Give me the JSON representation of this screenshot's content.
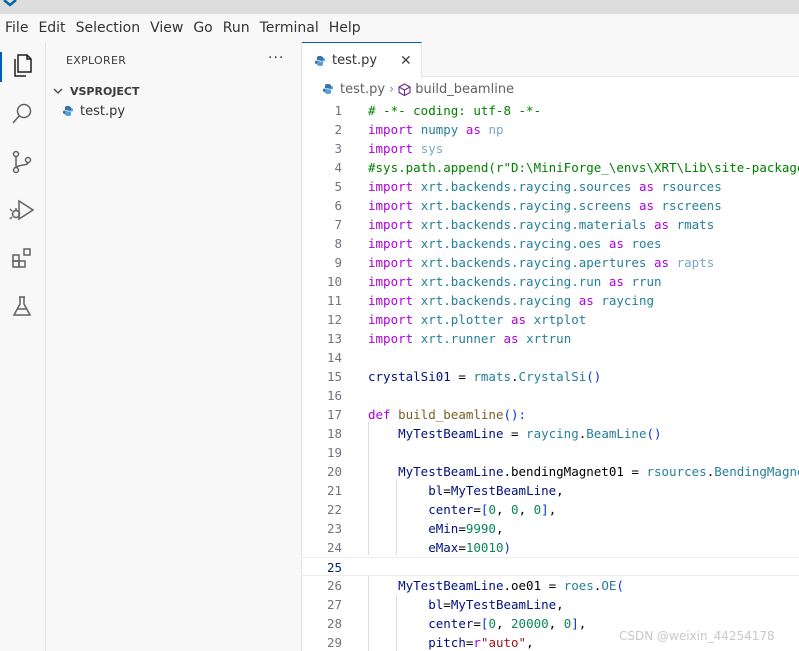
{
  "menu": [
    "File",
    "Edit",
    "Selection",
    "View",
    "Go",
    "Run",
    "Terminal",
    "Help"
  ],
  "activity_icons": [
    "explorer-icon",
    "search-icon",
    "source-control-icon",
    "run-debug-icon",
    "extensions-icon",
    "testing-icon"
  ],
  "sidebar": {
    "title": "EXPLORER",
    "more": "···",
    "folder": "VSPROJECT",
    "files": [
      "test.py"
    ]
  },
  "tab": {
    "label": "test.py",
    "close": "✕"
  },
  "breadcrumb": {
    "file": "test.py",
    "sep": "›",
    "symbol": "build_beamline"
  },
  "editor": {
    "current_line": 25,
    "lines": [
      {
        "n": "1",
        "t": [
          [
            "# -*- coding: utf-8 -*-",
            "c"
          ]
        ]
      },
      {
        "n": "2",
        "t": [
          [
            "import",
            "k"
          ],
          [
            " ",
            "o"
          ],
          [
            "numpy",
            "m"
          ],
          [
            " ",
            "o"
          ],
          [
            "as",
            "k"
          ],
          [
            " ",
            "o"
          ],
          [
            "np",
            "dim"
          ]
        ]
      },
      {
        "n": "3",
        "t": [
          [
            "import",
            "k"
          ],
          [
            " ",
            "o"
          ],
          [
            "sys",
            "dim"
          ]
        ]
      },
      {
        "n": "4",
        "t": [
          [
            "#sys.path.append(r\"D:\\MiniForge_\\envs\\XRT\\Lib\\site-packages\")",
            "c"
          ]
        ]
      },
      {
        "n": "5",
        "t": [
          [
            "import",
            "k"
          ],
          [
            " ",
            "o"
          ],
          [
            "xrt.backends.raycing.sources",
            "m"
          ],
          [
            " ",
            "o"
          ],
          [
            "as",
            "k"
          ],
          [
            " ",
            "o"
          ],
          [
            "rsources",
            "m"
          ]
        ]
      },
      {
        "n": "6",
        "t": [
          [
            "import",
            "k"
          ],
          [
            " ",
            "o"
          ],
          [
            "xrt.backends.raycing.screens",
            "m"
          ],
          [
            " ",
            "o"
          ],
          [
            "as",
            "k"
          ],
          [
            " ",
            "o"
          ],
          [
            "rscreens",
            "m"
          ]
        ]
      },
      {
        "n": "7",
        "t": [
          [
            "import",
            "k"
          ],
          [
            " ",
            "o"
          ],
          [
            "xrt.backends.raycing.materials",
            "m"
          ],
          [
            " ",
            "o"
          ],
          [
            "as",
            "k"
          ],
          [
            " ",
            "o"
          ],
          [
            "rmats",
            "m"
          ]
        ]
      },
      {
        "n": "8",
        "t": [
          [
            "import",
            "k"
          ],
          [
            " ",
            "o"
          ],
          [
            "xrt.backends.raycing.oes",
            "m"
          ],
          [
            " ",
            "o"
          ],
          [
            "as",
            "k"
          ],
          [
            " ",
            "o"
          ],
          [
            "roes",
            "m"
          ]
        ]
      },
      {
        "n": "9",
        "t": [
          [
            "import",
            "k"
          ],
          [
            " ",
            "o"
          ],
          [
            "xrt.backends.raycing.apertures",
            "m"
          ],
          [
            " ",
            "o"
          ],
          [
            "as",
            "k"
          ],
          [
            " ",
            "o"
          ],
          [
            "rapts",
            "dim"
          ]
        ]
      },
      {
        "n": "10",
        "t": [
          [
            "import",
            "k"
          ],
          [
            " ",
            "o"
          ],
          [
            "xrt.backends.raycing.run",
            "m"
          ],
          [
            " ",
            "o"
          ],
          [
            "as",
            "k"
          ],
          [
            " ",
            "o"
          ],
          [
            "rrun",
            "m"
          ]
        ]
      },
      {
        "n": "11",
        "t": [
          [
            "import",
            "k"
          ],
          [
            " ",
            "o"
          ],
          [
            "xrt.backends.raycing",
            "m"
          ],
          [
            " ",
            "o"
          ],
          [
            "as",
            "k"
          ],
          [
            " ",
            "o"
          ],
          [
            "raycing",
            "m"
          ]
        ]
      },
      {
        "n": "12",
        "t": [
          [
            "import",
            "k"
          ],
          [
            " ",
            "o"
          ],
          [
            "xrt.plotter",
            "m"
          ],
          [
            " ",
            "o"
          ],
          [
            "as",
            "k"
          ],
          [
            " ",
            "o"
          ],
          [
            "xrtplot",
            "m"
          ]
        ]
      },
      {
        "n": "13",
        "t": [
          [
            "import",
            "k"
          ],
          [
            " ",
            "o"
          ],
          [
            "xrt.runner",
            "m"
          ],
          [
            " ",
            "o"
          ],
          [
            "as",
            "k"
          ],
          [
            " ",
            "o"
          ],
          [
            "xrtrun",
            "m"
          ]
        ]
      },
      {
        "n": "14",
        "t": []
      },
      {
        "n": "15",
        "t": [
          [
            "crystalSi01",
            "v"
          ],
          [
            " = ",
            "o"
          ],
          [
            "rmats",
            "m"
          ],
          [
            ".",
            "o"
          ],
          [
            "CrystalSi",
            "m"
          ],
          [
            "()",
            "p"
          ]
        ]
      },
      {
        "n": "16",
        "t": []
      },
      {
        "n": "17",
        "t": [
          [
            "def",
            "k"
          ],
          [
            " ",
            "o"
          ],
          [
            "build_beamline",
            "f"
          ],
          [
            "():",
            "p"
          ]
        ]
      },
      {
        "n": "18",
        "t": [
          [
            "    ",
            "o"
          ],
          [
            "MyTestBeamLine",
            "v"
          ],
          [
            " = ",
            "o"
          ],
          [
            "raycing",
            "m"
          ],
          [
            ".",
            "o"
          ],
          [
            "BeamLine",
            "m"
          ],
          [
            "()",
            "p"
          ]
        ]
      },
      {
        "n": "19",
        "t": []
      },
      {
        "n": "20",
        "t": [
          [
            "    ",
            "o"
          ],
          [
            "MyTestBeamLine",
            "v"
          ],
          [
            ".bendingMagnet01 = ",
            "o"
          ],
          [
            "rsources",
            "m"
          ],
          [
            ".",
            "o"
          ],
          [
            "BendingMagnet",
            "m"
          ],
          [
            "(",
            "p"
          ]
        ]
      },
      {
        "n": "21",
        "t": [
          [
            "        ",
            "o"
          ],
          [
            "bl",
            "v"
          ],
          [
            "=",
            "o"
          ],
          [
            "MyTestBeamLine",
            "v"
          ],
          [
            ",",
            "o"
          ]
        ]
      },
      {
        "n": "22",
        "t": [
          [
            "        ",
            "o"
          ],
          [
            "center",
            "v"
          ],
          [
            "=",
            "o"
          ],
          [
            "[",
            "p"
          ],
          [
            "0",
            "n"
          ],
          [
            ", ",
            "o"
          ],
          [
            "0",
            "n"
          ],
          [
            ", ",
            "o"
          ],
          [
            "0",
            "n"
          ],
          [
            "]",
            "p"
          ],
          [
            ",",
            "o"
          ]
        ]
      },
      {
        "n": "23",
        "t": [
          [
            "        ",
            "o"
          ],
          [
            "eMin",
            "v"
          ],
          [
            "=",
            "o"
          ],
          [
            "9990",
            "n"
          ],
          [
            ",",
            "o"
          ]
        ]
      },
      {
        "n": "24",
        "t": [
          [
            "        ",
            "o"
          ],
          [
            "eMax",
            "v"
          ],
          [
            "=",
            "o"
          ],
          [
            "10010",
            "n"
          ],
          [
            ")",
            "p"
          ]
        ]
      },
      {
        "n": "25",
        "t": []
      },
      {
        "n": "26",
        "t": [
          [
            "    ",
            "o"
          ],
          [
            "MyTestBeamLine",
            "v"
          ],
          [
            ".oe01 = ",
            "o"
          ],
          [
            "roes",
            "m"
          ],
          [
            ".",
            "o"
          ],
          [
            "OE",
            "m"
          ],
          [
            "(",
            "p"
          ]
        ]
      },
      {
        "n": "27",
        "t": [
          [
            "        ",
            "o"
          ],
          [
            "bl",
            "v"
          ],
          [
            "=",
            "o"
          ],
          [
            "MyTestBeamLine",
            "v"
          ],
          [
            ",",
            "o"
          ]
        ]
      },
      {
        "n": "28",
        "t": [
          [
            "        ",
            "o"
          ],
          [
            "center",
            "v"
          ],
          [
            "=",
            "o"
          ],
          [
            "[",
            "p"
          ],
          [
            "0",
            "n"
          ],
          [
            ", ",
            "o"
          ],
          [
            "20000",
            "n"
          ],
          [
            ", ",
            "o"
          ],
          [
            "0",
            "n"
          ],
          [
            "]",
            "p"
          ],
          [
            ",",
            "o"
          ]
        ]
      },
      {
        "n": "29",
        "t": [
          [
            "        ",
            "o"
          ],
          [
            "pitch",
            "v"
          ],
          [
            "=",
            "o"
          ],
          [
            "r",
            "k"
          ],
          [
            "\"auto\"",
            "s"
          ],
          [
            ",",
            "o"
          ]
        ]
      }
    ]
  },
  "watermark": "CSDN @weixin_44254178"
}
